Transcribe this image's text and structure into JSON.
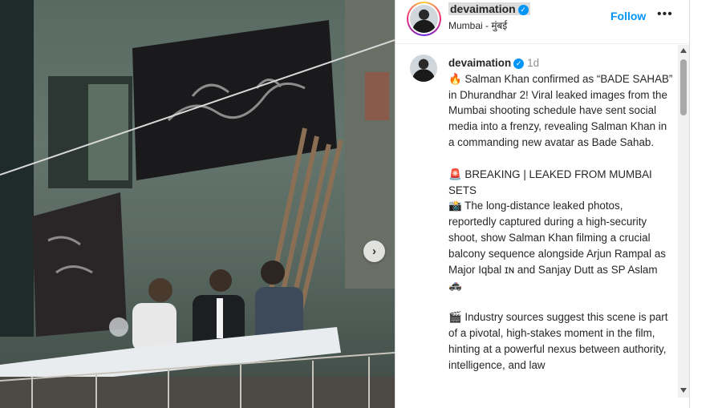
{
  "colors": {
    "accent": "#0095f6",
    "text": "#262626",
    "muted": "#8e8e8e"
  },
  "photo": {
    "next_icon": "chevron-right-icon",
    "next_glyph": "›"
  },
  "header": {
    "username": "devaimation",
    "location": "Mumbai - मुंबई",
    "follow_label": "Follow",
    "more_label": "•••"
  },
  "caption": {
    "username": "devaimation",
    "time": "1d",
    "p1": "🔥 Salman Khan confirmed as “BADE SAHAB” in Dhurandhar 2! Viral leaked images from the Mumbai shooting schedule have sent social media into a frenzy, revealing Salman Khan in a commanding new avatar as Bade Sahab.",
    "p2": "🚨 BREAKING | LEAKED FROM MUMBAI SETS\n📸 The long-distance leaked photos, reportedly captured during a high-security shoot, show Salman Khan filming a crucial balcony sequence alongside Arjun Rampal as Major Iqbal ɪɴ and Sanjay Dutt as SP Aslam 🚓",
    "p3": "🎬 Industry sources suggest this scene is part of a pivotal, high-stakes moment in the film, hinting at a powerful nexus between authority, intelligence, and law"
  }
}
